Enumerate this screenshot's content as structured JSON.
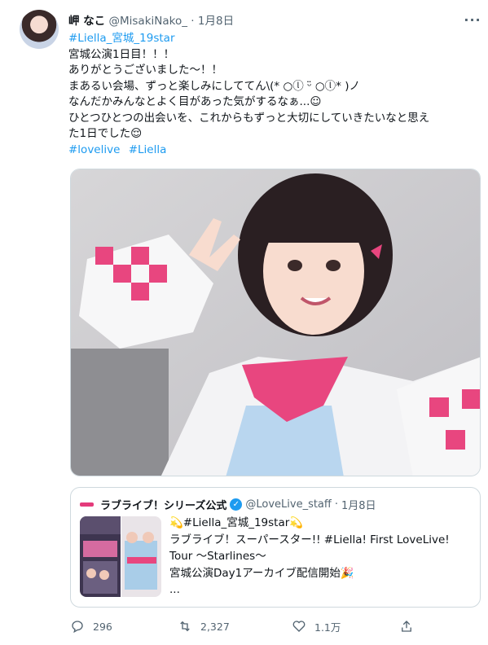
{
  "tweet": {
    "display_name": "岬 なこ",
    "handle": "@MisakiNako_",
    "separator": "·",
    "date": "1月8日",
    "lines": [
      {
        "text": "#Liella_宮城_19star",
        "is_tag": true
      },
      {
        "text": "宮城公演1日目！！！",
        "is_tag": false
      },
      {
        "text": "ありがとうございました〜！！",
        "is_tag": false
      },
      {
        "text": "まあるい会場、ずっと楽しみにしててん\\(* ○ⓛ ᵕ̈ ○ⓛ* )ノ",
        "is_tag": false
      },
      {
        "text": "なんだかみんなとよく目があった気がするなぁ...☺",
        "is_tag": false
      },
      {
        "text": "ひとつひとつの出会いを、これからもずっと大切にしていきたいなと思え",
        "is_tag": false
      },
      {
        "text": "た1日でした😌",
        "is_tag": false
      }
    ],
    "hashtags": [
      "#lovelive",
      "#Liella"
    ]
  },
  "quote": {
    "display_name": "ラブライブ！シリーズ公式",
    "handle": "@LoveLive_staff",
    "separator": "·",
    "date": "1月8日",
    "lines": [
      "💫#Liella_宮城_19star💫",
      "ラブライブ！スーパースター!! #Liella! First LoveLive!",
      "Tour 〜Starlines〜",
      "宮城公演Day1アーカイブ配信開始🎉",
      "..."
    ]
  },
  "actions": {
    "reply_count": "296",
    "retweet_count": "2,327",
    "like_count": "1.1万"
  },
  "icons": {
    "more": "more-icon",
    "reply": "reply-icon",
    "retweet": "retweet-icon",
    "like": "heart-icon",
    "share": "share-icon",
    "verified": "verified-badge-icon"
  },
  "colors": {
    "link": "#1d9bf0",
    "text": "#0f1419",
    "muted": "#536471",
    "brand_pink": "#e43b7b"
  }
}
